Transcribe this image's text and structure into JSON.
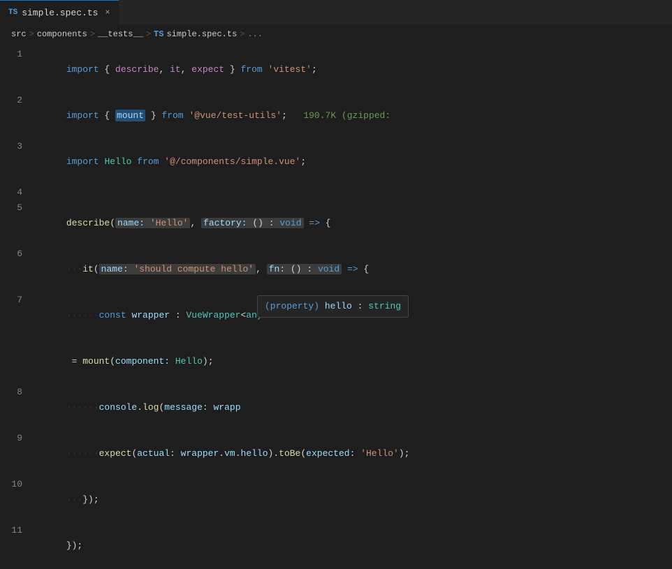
{
  "tab": {
    "ts_badge": "TS",
    "filename": "simple.spec.ts",
    "close": "×"
  },
  "breadcrumb": {
    "parts": [
      "src",
      ">",
      "components",
      ">",
      "__tests__",
      ">",
      "TS simple.spec.ts",
      ">",
      "..."
    ]
  },
  "lines": [
    {
      "num": "1",
      "tokens": [
        {
          "cls": "kw",
          "text": "import"
        },
        {
          "cls": "punct",
          "text": " { "
        },
        {
          "cls": "kw2",
          "text": "describe"
        },
        {
          "cls": "punct",
          "text": ", "
        },
        {
          "cls": "kw2",
          "text": "it"
        },
        {
          "cls": "punct",
          "text": ", "
        },
        {
          "cls": "kw2",
          "text": "expect"
        },
        {
          "cls": "punct",
          "text": " } "
        },
        {
          "cls": "kw",
          "text": "from"
        },
        {
          "cls": "punct",
          "text": " "
        },
        {
          "cls": "str",
          "text": "'vitest'"
        },
        {
          "cls": "punct",
          "text": ";"
        }
      ]
    },
    {
      "num": "2",
      "tokens": [
        {
          "cls": "kw",
          "text": "import"
        },
        {
          "cls": "punct",
          "text": " { "
        },
        {
          "cls": "var",
          "text": "mount"
        },
        {
          "cls": "punct",
          "text": " } "
        },
        {
          "cls": "kw",
          "text": "from"
        },
        {
          "cls": "punct",
          "text": " "
        },
        {
          "cls": "str",
          "text": "'@vue/test-utils'"
        },
        {
          "cls": "punct",
          "text": ";   "
        },
        {
          "cls": "size-hint",
          "text": "190.7K (gzipped:"
        }
      ]
    },
    {
      "num": "3",
      "tokens": [
        {
          "cls": "kw",
          "text": "import"
        },
        {
          "cls": "punct",
          "text": " "
        },
        {
          "cls": "type",
          "text": "Hello"
        },
        {
          "cls": "punct",
          "text": " "
        },
        {
          "cls": "kw",
          "text": "from"
        },
        {
          "cls": "punct",
          "text": " "
        },
        {
          "cls": "str",
          "text": "'@/components/simple.vue'"
        },
        {
          "cls": "punct",
          "text": ";"
        }
      ]
    },
    {
      "num": "4",
      "tokens": []
    },
    {
      "num": "5",
      "tokens": [
        {
          "cls": "fn",
          "text": "describe"
        },
        {
          "cls": "punct",
          "text": "("
        },
        {
          "cls": "param-box-start",
          "text": ""
        },
        {
          "cls": "param-label",
          "text": "name:"
        },
        {
          "cls": "punct",
          "text": " "
        },
        {
          "cls": "str",
          "text": "'Hello'"
        },
        {
          "cls": "param-box-end",
          "text": ""
        },
        {
          "cls": "punct",
          "text": ", "
        },
        {
          "cls": "param-box-start",
          "text": ""
        },
        {
          "cls": "param-label",
          "text": "factory:"
        },
        {
          "cls": "punct",
          "text": " () : "
        },
        {
          "cls": "kw",
          "text": "void"
        },
        {
          "cls": "param-box-end",
          "text": ""
        },
        {
          "cls": "punct",
          "text": " "
        },
        {
          "cls": "arrow",
          "text": "=>"
        },
        {
          "cls": "punct",
          "text": " {"
        }
      ]
    },
    {
      "num": "6",
      "tokens": [
        {
          "cls": "dot",
          "text": "···"
        },
        {
          "cls": "fn",
          "text": "it"
        },
        {
          "cls": "punct",
          "text": "("
        },
        {
          "cls": "param-box-start",
          "text": ""
        },
        {
          "cls": "param-label",
          "text": "name:"
        },
        {
          "cls": "punct",
          "text": " "
        },
        {
          "cls": "str",
          "text": "'should compute hello'"
        },
        {
          "cls": "param-box-end",
          "text": ""
        },
        {
          "cls": "punct",
          "text": ", "
        },
        {
          "cls": "param-box-start",
          "text": ""
        },
        {
          "cls": "param-label",
          "text": "fn:"
        },
        {
          "cls": "punct",
          "text": " () : "
        },
        {
          "cls": "kw",
          "text": "void"
        },
        {
          "cls": "param-box-end",
          "text": ""
        },
        {
          "cls": "punct",
          "text": " "
        },
        {
          "cls": "arrow",
          "text": "=>"
        },
        {
          "cls": "punct",
          "text": " {"
        }
      ]
    },
    {
      "num": "7",
      "tokens": [
        {
          "cls": "dot",
          "text": "···"
        },
        {
          "cls": "dot",
          "text": "···"
        },
        {
          "cls": "kw",
          "text": "const"
        },
        {
          "cls": "punct",
          "text": " "
        },
        {
          "cls": "var",
          "text": "wrapper"
        },
        {
          "cls": "punct",
          "text": " : "
        },
        {
          "cls": "type",
          "text": "VueWrapper"
        },
        {
          "cls": "punct",
          "text": "<"
        },
        {
          "cls": "type",
          "text": "any"
        }
      ],
      "has_tooltip": true
    },
    {
      "num": "8",
      "tokens": [
        {
          "cls": "dot",
          "text": "···"
        },
        {
          "cls": "dot",
          "text": "···"
        },
        {
          "cls": "var",
          "text": "console"
        },
        {
          "cls": "punct",
          "text": "."
        },
        {
          "cls": "fn",
          "text": "log"
        },
        {
          "cls": "punct",
          "text": "("
        },
        {
          "cls": "param-label",
          "text": "message:"
        },
        {
          "cls": "punct",
          "text": " "
        },
        {
          "cls": "var",
          "text": "wrapp"
        }
      ]
    },
    {
      "num": "9",
      "tokens": [
        {
          "cls": "dot",
          "text": "···"
        },
        {
          "cls": "dot",
          "text": "···"
        },
        {
          "cls": "fn",
          "text": "expect"
        },
        {
          "cls": "punct",
          "text": "("
        },
        {
          "cls": "param-label",
          "text": "actual:"
        },
        {
          "cls": "punct",
          "text": " "
        },
        {
          "cls": "var",
          "text": "wrapper"
        },
        {
          "cls": "punct",
          "text": "."
        },
        {
          "cls": "var",
          "text": "vm"
        },
        {
          "cls": "punct",
          "text": "."
        },
        {
          "cls": "var",
          "text": "hello"
        },
        {
          "cls": "punct",
          "text": ")."
        },
        {
          "cls": "fn",
          "text": "toBe"
        },
        {
          "cls": "punct",
          "text": "("
        },
        {
          "cls": "param-label",
          "text": "expected:"
        },
        {
          "cls": "punct",
          "text": " "
        },
        {
          "cls": "str",
          "text": "'Hello'"
        },
        {
          "cls": "punct",
          "text": ");"
        }
      ]
    },
    {
      "num": "10",
      "tokens": [
        {
          "cls": "dot",
          "text": "···"
        },
        {
          "cls": "punct",
          "text": "});"
        }
      ]
    },
    {
      "num": "11",
      "tokens": [
        {
          "cls": "punct",
          "text": "});"
        }
      ]
    }
  ],
  "tooltip": {
    "keyword": "(property)",
    "var": "hello",
    "colon": ":",
    "type": "string"
  }
}
